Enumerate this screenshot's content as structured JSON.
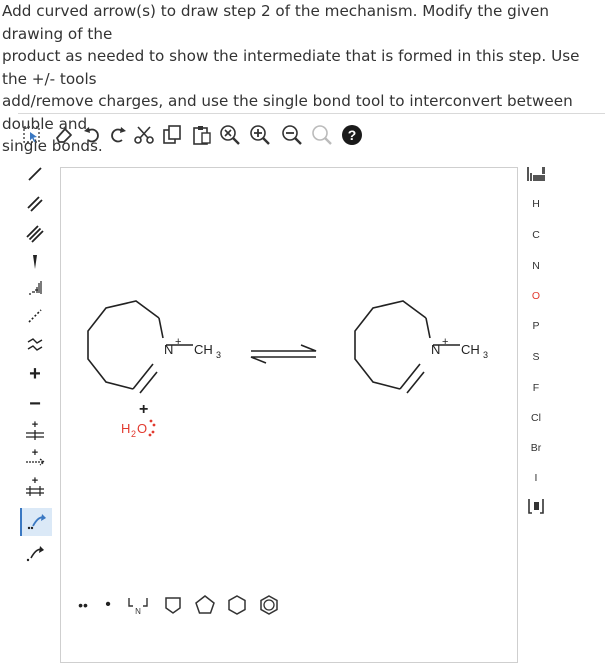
{
  "question": {
    "lines": [
      "Add curved arrow(s) to draw step 2 of the mechanism. Modify the given drawing of the",
      "product as needed to show the intermediate that is formed in this step. Use the +/- tools",
      "add/remove charges, and use the single bond tool to interconvert between double and",
      "single bonds."
    ]
  },
  "toolbar": {
    "tools": [
      {
        "name": "select-lasso-icon"
      },
      {
        "name": "eraser-icon"
      },
      {
        "name": "undo-icon"
      },
      {
        "name": "redo-icon"
      },
      {
        "name": "cut-icon"
      },
      {
        "name": "copy-icon"
      },
      {
        "name": "paste-icon"
      },
      {
        "name": "zoom-reset-icon"
      },
      {
        "name": "zoom-in-icon"
      },
      {
        "name": "zoom-out-icon"
      },
      {
        "name": "clean-icon"
      },
      {
        "name": "help-icon",
        "label": "?"
      }
    ]
  },
  "left_tools": [
    {
      "name": "single-bond-icon"
    },
    {
      "name": "double-bond-icon"
    },
    {
      "name": "triple-bond-icon"
    },
    {
      "name": "wedge-bond-icon"
    },
    {
      "name": "hash-bond-icon"
    },
    {
      "name": "dashed-bond-icon"
    },
    {
      "name": "chain-icon"
    },
    {
      "name": "positive-charge-icon",
      "label": "+"
    },
    {
      "name": "negative-charge-icon",
      "label": "−"
    },
    {
      "name": "charge-arrow-1-icon",
      "label": "+"
    },
    {
      "name": "charge-arrow-2-icon",
      "label": "+"
    },
    {
      "name": "charge-arrow-3-icon",
      "label": "+"
    },
    {
      "name": "curved-arrow-double-icon",
      "selected": true
    },
    {
      "name": "curved-arrow-single-icon"
    }
  ],
  "elements": [
    "H",
    "C",
    "N",
    "O",
    "P",
    "S",
    "F",
    "Cl",
    "Br",
    "I"
  ],
  "element_colors": {
    "O": "#e23a2f",
    "default": "#333333"
  },
  "bottom_tools": [
    {
      "name": "lone-pair-icon",
      "label": "••"
    },
    {
      "name": "radical-icon",
      "label": "•"
    },
    {
      "name": "atom-template-icon",
      "label": "N"
    },
    {
      "name": "cyclopentane-icon"
    },
    {
      "name": "pentagon-icon"
    },
    {
      "name": "hexagon-icon"
    },
    {
      "name": "benzene-icon"
    }
  ],
  "canvas": {
    "left_molecule": {
      "n_label": "N",
      "charge": "+",
      "methyl": "CH",
      "methyl_sub": "3"
    },
    "right_molecule": {
      "n_label": "N",
      "charge": "+",
      "methyl": "CH",
      "methyl_sub": "3"
    },
    "water": {
      "h": "H",
      "sub": "2",
      "o": "O",
      "charge": "+"
    }
  }
}
